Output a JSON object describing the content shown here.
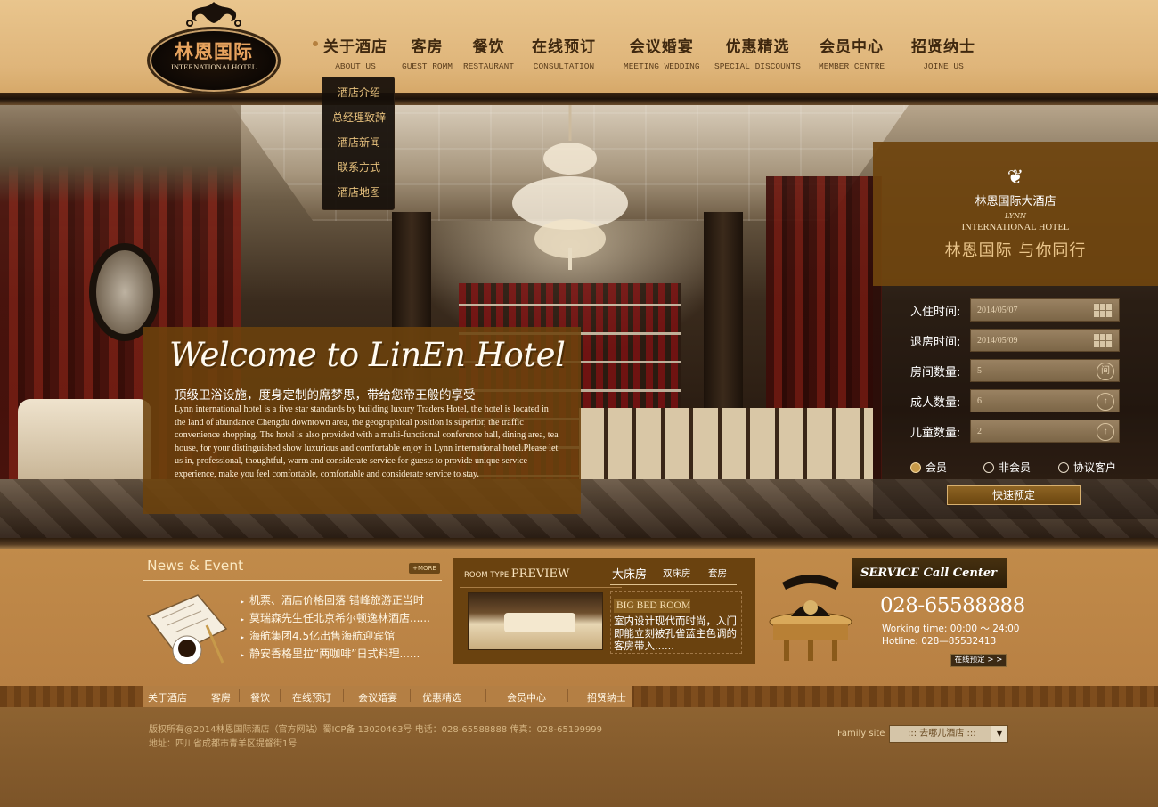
{
  "logo": {
    "title": "林恩国际",
    "subtitle": "INTERNATIONALHOTEL"
  },
  "nav": [
    {
      "cn": "关于酒店",
      "en": "ABOUT US"
    },
    {
      "cn": "客房",
      "en": "GUEST ROMM"
    },
    {
      "cn": "餐饮",
      "en": "RESTAURANT"
    },
    {
      "cn": "在线预订",
      "en": "CONSULTATION"
    },
    {
      "cn": "会议婚宴",
      "en": "MEETING WEDDING"
    },
    {
      "cn": "优惠精选",
      "en": "SPECIAL DISCOUNTS"
    },
    {
      "cn": "会员中心",
      "en": "MEMBER CENTRE"
    },
    {
      "cn": "招贤纳士",
      "en": "JOINE US"
    }
  ],
  "dropdown": [
    "酒店介绍",
    "总经理致辞",
    "酒店新闻",
    "联系方式",
    "酒店地图"
  ],
  "welcome": {
    "title": "Welcome to LinEn Hotel",
    "subtitle": "顶级卫浴设施，度身定制的席梦思，带给您帝王般的享受",
    "text": "Lynn international hotel is a five star standards by building luxury Traders Hotel, the hotel is located in the land of abundance Chengdu downtown area, the geographical position is superior, the traffic convenience shopping. The hotel is also provided with a multi-functional conference hall, dining area, tea house, for your distinguished show luxurious and comfortable enjoy in Lynn international hotel.Please let us in, professional, thoughtful, warm and considerate service for guests to provide unique service experience, make you feel comfortable, comfortable and considerate service to stay."
  },
  "booking": {
    "hotel_name": "林恩国际大酒店",
    "script": "LYNN",
    "en_name": "INTERNATIONAL HOTEL",
    "slogan": "林恩国际  与你同行",
    "fields": [
      {
        "label": "入住时间:",
        "value": "2014/05/07",
        "control": "calendar-icon"
      },
      {
        "label": "退房时间:",
        "value": "2014/05/09",
        "control": "calendar-icon"
      },
      {
        "label": "房间数量:",
        "value": "5",
        "control": "间"
      },
      {
        "label": "成人数量:",
        "value": "6",
        "control": "up-arrow-icon"
      },
      {
        "label": "儿童数量:",
        "value": "2",
        "control": "up-arrow-icon"
      }
    ],
    "options": [
      {
        "label": "会员",
        "selected": true
      },
      {
        "label": "非会员",
        "selected": false
      },
      {
        "label": "协议客户",
        "selected": false
      }
    ],
    "submit_label": "快速预定"
  },
  "news": {
    "title": "News & Event",
    "more_label": "MORE",
    "items": [
      "机票、酒店价格回落 错峰旅游正当时",
      "莫瑞森先生任北京希尔顿逸林酒店......",
      "海航集团4.5亿出售海航迎宾馆",
      "静安香格里拉“两咖啡”日式料理......"
    ]
  },
  "preview": {
    "label_small": "ROOM TYPE",
    "label_big": "PREVIEW",
    "tabs": [
      "大床房",
      "双床房",
      "套房"
    ],
    "active_tab": "大床房",
    "room_title": "BIG BED ROOM",
    "description": "室内设计现代而时尚，入门即能立刻被孔雀蓝主色调的客房带入......"
  },
  "service": {
    "title": "SERVICE Call Center",
    "phone": "028-65588888",
    "working_time": "Working time: 00:00 ～ 24:00",
    "hotline": "Hotline: 028—85532413",
    "online_button": "在线预定 > >"
  },
  "footer_nav": [
    "关于酒店",
    "客房",
    "餐饮",
    "在线预订",
    "会议婚宴",
    "优惠精选",
    "会员中心",
    "招贤纳士"
  ],
  "footer": {
    "copyright_line1": "版权所有@2014林恩国际酒店（官方网站）蜀ICP备 13020463号 电话：028-65588888 传真：028-65199999",
    "copyright_line2": "地址：四川省成都市青羊区提督街1号",
    "family_label": "Family site",
    "family_select": ":::  去哪儿酒店  :::"
  },
  "colors": {
    "header_bg": "#dfb57a",
    "panel_brown": "#6e440e",
    "accent_gold": "#e9c48a",
    "footer_bg": "#8e6331"
  }
}
